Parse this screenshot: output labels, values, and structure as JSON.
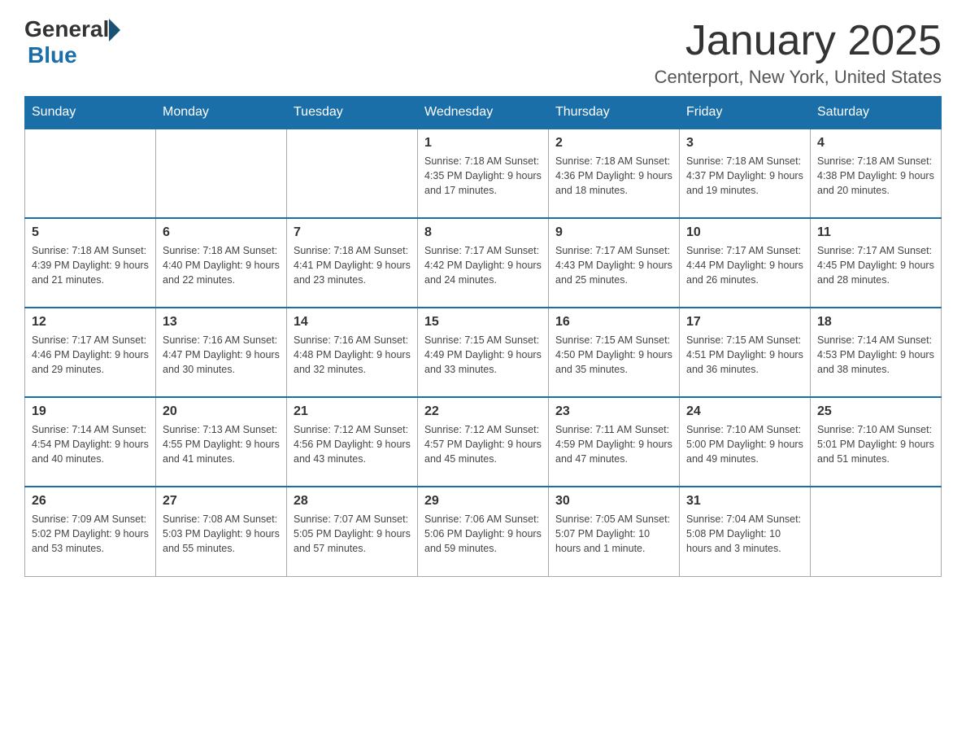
{
  "header": {
    "logo_general": "General",
    "logo_blue": "Blue",
    "month_title": "January 2025",
    "location": "Centerport, New York, United States"
  },
  "weekdays": [
    "Sunday",
    "Monday",
    "Tuesday",
    "Wednesday",
    "Thursday",
    "Friday",
    "Saturday"
  ],
  "weeks": [
    [
      {
        "day": "",
        "info": ""
      },
      {
        "day": "",
        "info": ""
      },
      {
        "day": "",
        "info": ""
      },
      {
        "day": "1",
        "info": "Sunrise: 7:18 AM\nSunset: 4:35 PM\nDaylight: 9 hours\nand 17 minutes."
      },
      {
        "day": "2",
        "info": "Sunrise: 7:18 AM\nSunset: 4:36 PM\nDaylight: 9 hours\nand 18 minutes."
      },
      {
        "day": "3",
        "info": "Sunrise: 7:18 AM\nSunset: 4:37 PM\nDaylight: 9 hours\nand 19 minutes."
      },
      {
        "day": "4",
        "info": "Sunrise: 7:18 AM\nSunset: 4:38 PM\nDaylight: 9 hours\nand 20 minutes."
      }
    ],
    [
      {
        "day": "5",
        "info": "Sunrise: 7:18 AM\nSunset: 4:39 PM\nDaylight: 9 hours\nand 21 minutes."
      },
      {
        "day": "6",
        "info": "Sunrise: 7:18 AM\nSunset: 4:40 PM\nDaylight: 9 hours\nand 22 minutes."
      },
      {
        "day": "7",
        "info": "Sunrise: 7:18 AM\nSunset: 4:41 PM\nDaylight: 9 hours\nand 23 minutes."
      },
      {
        "day": "8",
        "info": "Sunrise: 7:17 AM\nSunset: 4:42 PM\nDaylight: 9 hours\nand 24 minutes."
      },
      {
        "day": "9",
        "info": "Sunrise: 7:17 AM\nSunset: 4:43 PM\nDaylight: 9 hours\nand 25 minutes."
      },
      {
        "day": "10",
        "info": "Sunrise: 7:17 AM\nSunset: 4:44 PM\nDaylight: 9 hours\nand 26 minutes."
      },
      {
        "day": "11",
        "info": "Sunrise: 7:17 AM\nSunset: 4:45 PM\nDaylight: 9 hours\nand 28 minutes."
      }
    ],
    [
      {
        "day": "12",
        "info": "Sunrise: 7:17 AM\nSunset: 4:46 PM\nDaylight: 9 hours\nand 29 minutes."
      },
      {
        "day": "13",
        "info": "Sunrise: 7:16 AM\nSunset: 4:47 PM\nDaylight: 9 hours\nand 30 minutes."
      },
      {
        "day": "14",
        "info": "Sunrise: 7:16 AM\nSunset: 4:48 PM\nDaylight: 9 hours\nand 32 minutes."
      },
      {
        "day": "15",
        "info": "Sunrise: 7:15 AM\nSunset: 4:49 PM\nDaylight: 9 hours\nand 33 minutes."
      },
      {
        "day": "16",
        "info": "Sunrise: 7:15 AM\nSunset: 4:50 PM\nDaylight: 9 hours\nand 35 minutes."
      },
      {
        "day": "17",
        "info": "Sunrise: 7:15 AM\nSunset: 4:51 PM\nDaylight: 9 hours\nand 36 minutes."
      },
      {
        "day": "18",
        "info": "Sunrise: 7:14 AM\nSunset: 4:53 PM\nDaylight: 9 hours\nand 38 minutes."
      }
    ],
    [
      {
        "day": "19",
        "info": "Sunrise: 7:14 AM\nSunset: 4:54 PM\nDaylight: 9 hours\nand 40 minutes."
      },
      {
        "day": "20",
        "info": "Sunrise: 7:13 AM\nSunset: 4:55 PM\nDaylight: 9 hours\nand 41 minutes."
      },
      {
        "day": "21",
        "info": "Sunrise: 7:12 AM\nSunset: 4:56 PM\nDaylight: 9 hours\nand 43 minutes."
      },
      {
        "day": "22",
        "info": "Sunrise: 7:12 AM\nSunset: 4:57 PM\nDaylight: 9 hours\nand 45 minutes."
      },
      {
        "day": "23",
        "info": "Sunrise: 7:11 AM\nSunset: 4:59 PM\nDaylight: 9 hours\nand 47 minutes."
      },
      {
        "day": "24",
        "info": "Sunrise: 7:10 AM\nSunset: 5:00 PM\nDaylight: 9 hours\nand 49 minutes."
      },
      {
        "day": "25",
        "info": "Sunrise: 7:10 AM\nSunset: 5:01 PM\nDaylight: 9 hours\nand 51 minutes."
      }
    ],
    [
      {
        "day": "26",
        "info": "Sunrise: 7:09 AM\nSunset: 5:02 PM\nDaylight: 9 hours\nand 53 minutes."
      },
      {
        "day": "27",
        "info": "Sunrise: 7:08 AM\nSunset: 5:03 PM\nDaylight: 9 hours\nand 55 minutes."
      },
      {
        "day": "28",
        "info": "Sunrise: 7:07 AM\nSunset: 5:05 PM\nDaylight: 9 hours\nand 57 minutes."
      },
      {
        "day": "29",
        "info": "Sunrise: 7:06 AM\nSunset: 5:06 PM\nDaylight: 9 hours\nand 59 minutes."
      },
      {
        "day": "30",
        "info": "Sunrise: 7:05 AM\nSunset: 5:07 PM\nDaylight: 10 hours\nand 1 minute."
      },
      {
        "day": "31",
        "info": "Sunrise: 7:04 AM\nSunset: 5:08 PM\nDaylight: 10 hours\nand 3 minutes."
      },
      {
        "day": "",
        "info": ""
      }
    ]
  ]
}
